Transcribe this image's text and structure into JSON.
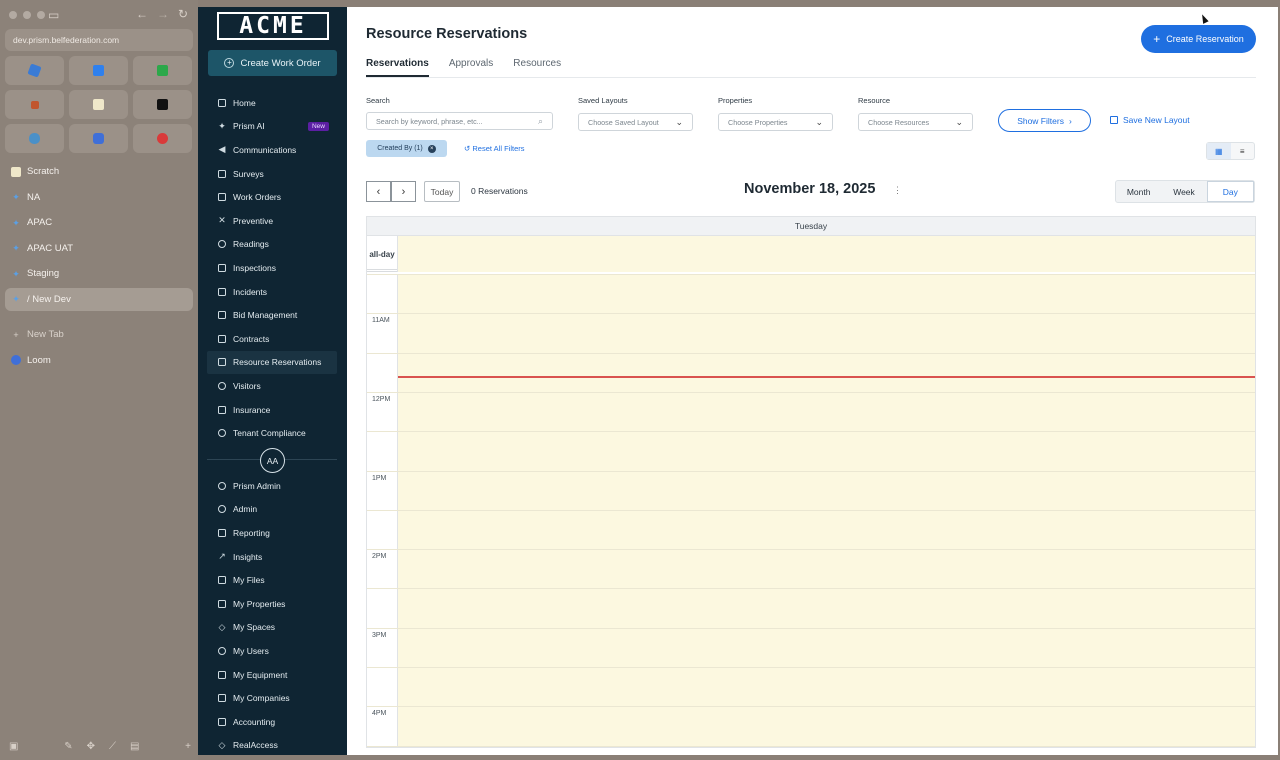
{
  "browser": {
    "url": "dev.prism.belfederation.com",
    "pinned": [
      {
        "icon": "app-icon-blue"
      },
      {
        "icon": "calendar-icon"
      },
      {
        "icon": "check-icon"
      },
      {
        "icon": "rocket-icon"
      },
      {
        "icon": "notes-icon"
      },
      {
        "icon": "t-icon"
      },
      {
        "icon": "cloud-icon"
      },
      {
        "icon": "loom-icon"
      },
      {
        "icon": "record-icon"
      }
    ],
    "items": [
      {
        "label": "Scratch"
      },
      {
        "label": "NA"
      },
      {
        "label": "APAC"
      },
      {
        "label": "APAC UAT"
      },
      {
        "label": "Staging"
      },
      {
        "label": "/ New Dev"
      }
    ],
    "new_tab": "New Tab",
    "loom": "Loom"
  },
  "app": {
    "logo": "ACME",
    "create_work_order": "Create Work Order",
    "nav": [
      {
        "label": "Home"
      },
      {
        "label": "Prism AI",
        "badge": "New"
      },
      {
        "label": "Communications"
      },
      {
        "label": "Surveys"
      },
      {
        "label": "Work Orders"
      },
      {
        "label": "Preventive"
      },
      {
        "label": "Readings"
      },
      {
        "label": "Inspections"
      },
      {
        "label": "Incidents"
      },
      {
        "label": "Bid Management"
      },
      {
        "label": "Contracts"
      },
      {
        "label": "Resource Reservations"
      },
      {
        "label": "Visitors"
      },
      {
        "label": "Insurance"
      },
      {
        "label": "Tenant Compliance"
      }
    ],
    "avatar": "AA",
    "nav2": [
      {
        "label": "Prism Admin"
      },
      {
        "label": "Admin"
      },
      {
        "label": "Reporting"
      },
      {
        "label": "Insights"
      },
      {
        "label": "My Files"
      },
      {
        "label": "My Properties"
      },
      {
        "label": "My Spaces"
      },
      {
        "label": "My Users"
      },
      {
        "label": "My Equipment"
      },
      {
        "label": "My Companies"
      },
      {
        "label": "Accounting"
      },
      {
        "label": "RealAccess"
      }
    ]
  },
  "main": {
    "title": "Resource Reservations",
    "create_reservation": "Create Reservation",
    "tabs": [
      {
        "label": "Reservations"
      },
      {
        "label": "Approvals"
      },
      {
        "label": "Resources"
      }
    ],
    "filters": {
      "search_label": "Search",
      "search_placeholder": "Search by keyword, phrase, etc...",
      "saved_layouts_label": "Saved Layouts",
      "saved_layouts_value": "Choose Saved Layout",
      "properties_label": "Properties",
      "properties_value": "Choose Properties",
      "resource_label": "Resource",
      "resource_value": "Choose Resources",
      "show_filters": "Show Filters",
      "save_layout": "Save New Layout",
      "chip": "Created By (1)",
      "reset": "Reset All Filters"
    },
    "calendar": {
      "today": "Today",
      "count": "0 Reservations",
      "date": "November 18, 2025",
      "views": [
        "Month",
        "Week",
        "Day"
      ],
      "active_view": "Day",
      "day_header": "Tuesday",
      "allday": "all-day",
      "hours": [
        "11AM",
        "12PM",
        "1PM",
        "2PM",
        "3PM",
        "4PM"
      ]
    }
  }
}
